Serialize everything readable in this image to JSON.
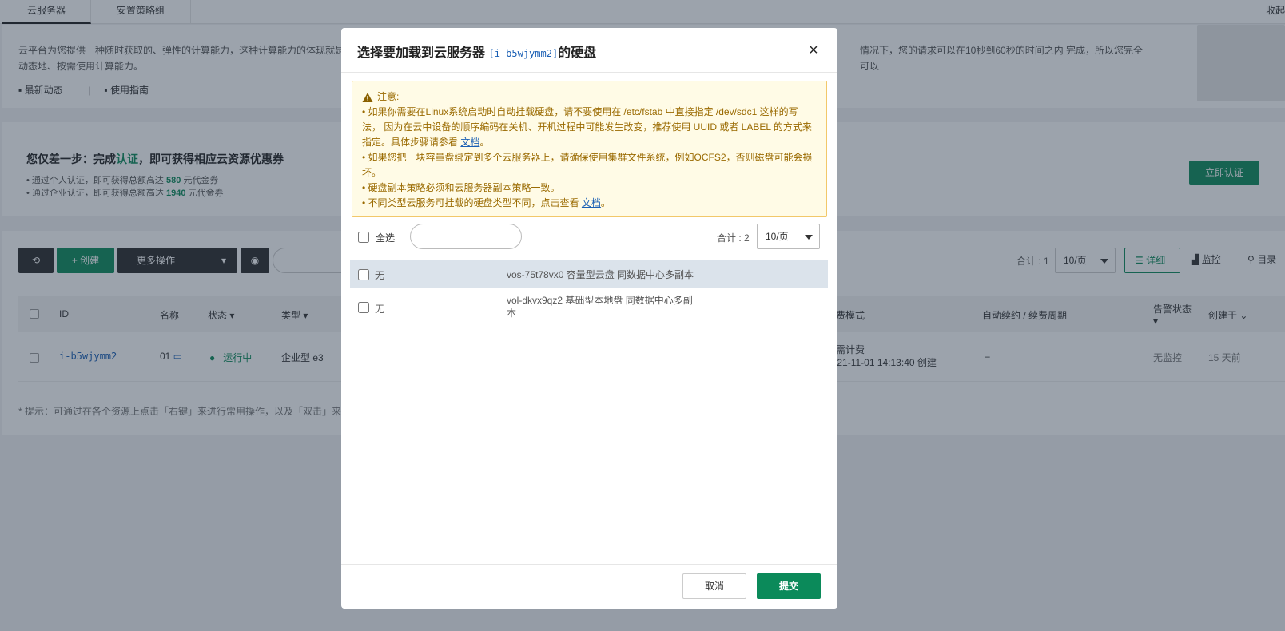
{
  "tabs": [
    "云服务器",
    "安置策略组"
  ],
  "collapse_label": "收起",
  "intro": {
    "text_a": "云平台为您提供一种随时获取的、弹性的计算能力，这种计算能力的体现就是",
    "text_b": "情况下，您的请求可以在10秒到60秒的时间之内 完成，所以您完全可以",
    "text_c": "动态地、按需使用计算能力。",
    "links": [
      "最新动态",
      "使用指南"
    ]
  },
  "promo": {
    "title_a": "您仅差一步：完成",
    "title_link": "认证",
    "title_b": "，即可获得相应云资源优惠券",
    "line1_a": "通过个人认证，即可获得总额高达",
    "line1_amount": "580",
    "line1_b": "元代金券",
    "line2_a": "通过企业认证，即可获得总额高达",
    "line2_amount": "1940",
    "line2_b": "元代金券",
    "button": "立即认证"
  },
  "toolbar": {
    "create": "+ 创建",
    "more": "更多操作",
    "total": "合计 : 1",
    "page_size": "10/页",
    "detail": "详细",
    "monitor": "监控",
    "directory": "目录"
  },
  "table": {
    "headers": {
      "id": "ID",
      "name": "名称",
      "status": "状态",
      "type": "类型",
      "billing": "计费模式",
      "renew": "自动续约 / 续费周期",
      "alarm": "告警状态",
      "created": "创建于"
    },
    "row": {
      "id": "i-b5wjymm2",
      "name": "01",
      "status": "运行中",
      "type": "企业型 e3",
      "billing": "按需计费",
      "billing_time": "2021-11-01 14:13:40 创建",
      "renew": "–",
      "alarm": "无监控",
      "created": "15 天前"
    }
  },
  "hint": "* 提示：可通过在各个资源上点击「右键」来进行常用操作，以及「双击」来",
  "modal": {
    "title_prefix": "选择要加载到云服务器",
    "instance_id": "[i-b5wjymm2]",
    "title_suffix": "的硬盘",
    "notice": {
      "heading": "注意:",
      "item1": "• 如果你需要在Linux系统启动时自动挂载硬盘，请不要使用在 /etc/fstab 中直接指定 /dev/sdc1 这样的写法， 因为在云中设备的顺序编码在关机、开机过程中可能发生改变，推荐使用 UUID 或者 LABEL 的方式来指定。具体步骤请参看",
      "item1_link": "文档",
      "item2": "• 如果您把一块容量盘绑定到多个云服务器上，请确保使用集群文件系统，例如OCFS2，否则磁盘可能会损坏。",
      "item3": "• 硬盘副本策略必须和云服务器副本策略一致。",
      "item4": "• 不同类型云服务可挂载的硬盘类型不同，点击查看",
      "item4_link": "文档",
      "period": "。"
    },
    "select_all": "全选",
    "search_value": "",
    "total": "合计 : 2",
    "page_size": "10/页",
    "disks": [
      {
        "name": "无",
        "desc": "vos-75t78vx0 容量型云盘 同数据中心多副本",
        "selected": true
      },
      {
        "name": "无",
        "desc": "vol-dkvx9qz2 基础型本地盘 同数据中心多副本",
        "selected": false
      }
    ],
    "cancel": "取消",
    "submit": "提交"
  }
}
